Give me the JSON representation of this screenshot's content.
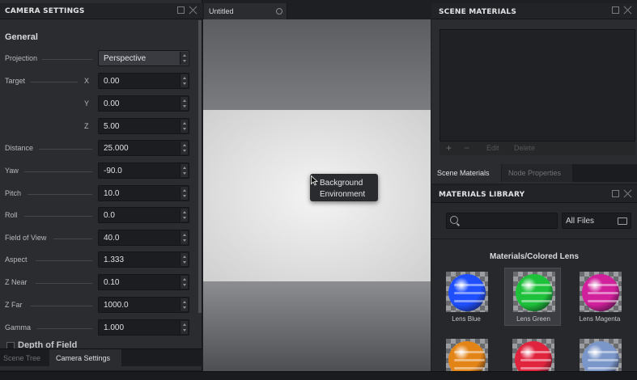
{
  "camera_settings": {
    "title": "CAMERA SETTINGS",
    "section_general": "General",
    "projection": {
      "label": "Projection",
      "value": "Perspective"
    },
    "target": {
      "label": "Target",
      "x": {
        "axis": "X",
        "value": "0.00"
      },
      "y": {
        "axis": "Y",
        "value": "0.00"
      },
      "z": {
        "axis": "Z",
        "value": "5.00"
      }
    },
    "fields": [
      {
        "label": "Distance",
        "value": "25.000"
      },
      {
        "label": "Yaw",
        "value": "-90.0"
      },
      {
        "label": "Pitch",
        "value": "10.0"
      },
      {
        "label": "Roll",
        "value": "0.0"
      },
      {
        "label": "Field of View",
        "value": "40.0"
      },
      {
        "label": "Aspect",
        "value": "1.333"
      },
      {
        "label": "Z Near",
        "value": "0.10"
      },
      {
        "label": "Z Far",
        "value": "1000.0"
      },
      {
        "label": "Gamma",
        "value": "1.000"
      }
    ],
    "section_dof": "Depth of Field"
  },
  "left_tabs": {
    "scene_tree": "Scene Tree",
    "camera_settings": "Camera Settings"
  },
  "viewport": {
    "tab_title": "Untitled",
    "context_menu": [
      "Background",
      "Environment"
    ]
  },
  "scene_materials": {
    "title": "SCENE MATERIALS",
    "toolbar": {
      "add": "+",
      "remove": "−",
      "edit": "Edit",
      "delete": "Delete"
    }
  },
  "right_tabs": {
    "scene_materials": "Scene Materials",
    "node_properties": "Node Properties"
  },
  "materials_library": {
    "title": "MATERIALS LIBRARY",
    "search_placeholder": "",
    "filter": "All Files",
    "category": "Materials/Colored Lens",
    "items": [
      {
        "name": "Lens Blue",
        "color": "#1f4fff"
      },
      {
        "name": "Lens Green",
        "color": "#1ec23a"
      },
      {
        "name": "Lens Magenta",
        "color": "#d0209b"
      },
      {
        "name": "",
        "color": "#e38417"
      },
      {
        "name": "",
        "color": "#e0243e"
      },
      {
        "name": "",
        "color": "#7b96c9"
      }
    ]
  }
}
